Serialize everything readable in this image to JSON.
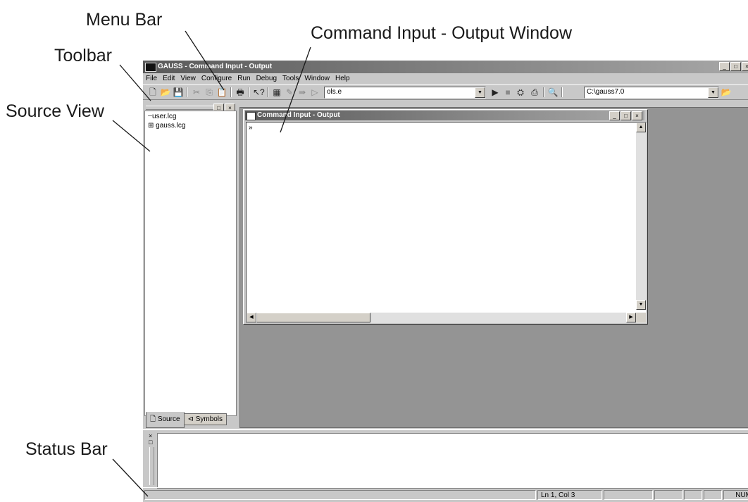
{
  "callouts": {
    "menu_bar": "Menu Bar",
    "command_window": "Command Input - Output Window",
    "toolbar": "Toolbar",
    "source_view": "Source View",
    "status_bar": "Status Bar"
  },
  "window": {
    "title": "GAUSS - Command Input - Output",
    "caption_buttons": [
      "_",
      "□",
      "×"
    ]
  },
  "menu": [
    "File",
    "Edit",
    "View",
    "Configure",
    "Run",
    "Debug",
    "Tools",
    "Window",
    "Help"
  ],
  "toolbar": {
    "icons": [
      "new-file-icon",
      "open-folder-icon",
      "save-icon",
      "cut-icon",
      "copy-icon",
      "paste-icon",
      "print-icon",
      "context-help-icon",
      "library-tool-icon",
      "edit-icon",
      "step-icon",
      "run-icon",
      "stop-icon",
      "debug-icon",
      "compile-icon",
      "graph-icon",
      "open-folder-icon"
    ],
    "file_combo": "ols.e",
    "dir_combo": "C:\\gauss7.0"
  },
  "source_view": {
    "tree": [
      "user.lcg",
      "gauss.lcg"
    ],
    "tabs": [
      "Source",
      "Symbols"
    ]
  },
  "command_window": {
    "title": "Command Input - Output",
    "prompt": "»"
  },
  "status": {
    "position": "Ln 1, Col 3",
    "num": "NUM"
  }
}
